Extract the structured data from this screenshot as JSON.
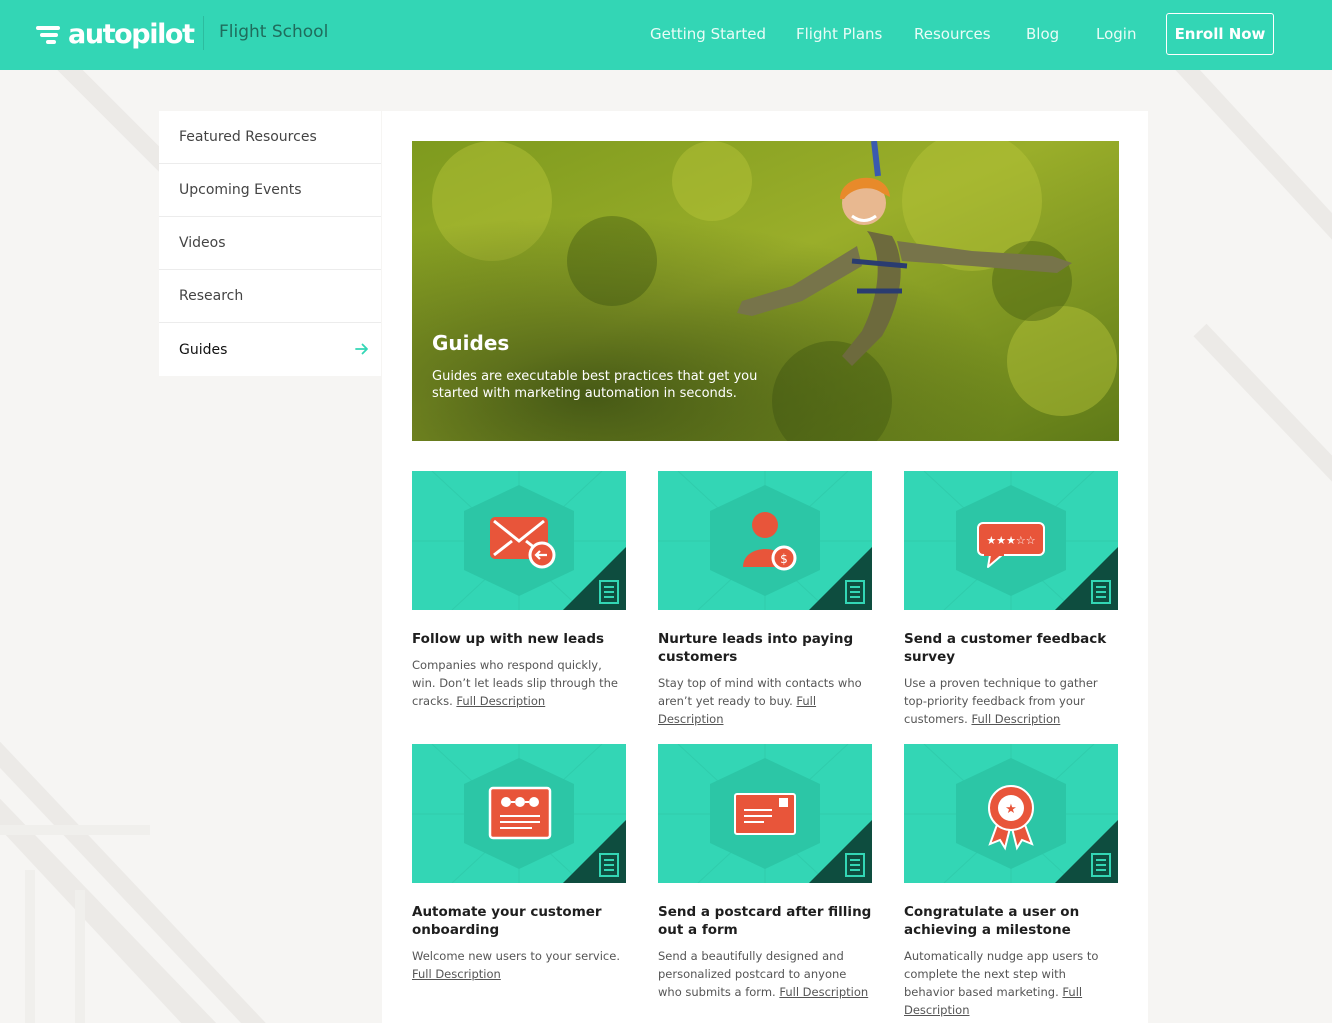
{
  "header": {
    "logo_text": "autopilot",
    "product_name": "Flight School",
    "nav": [
      "Getting Started",
      "Flight Plans",
      "Resources",
      "Blog",
      "Login"
    ],
    "cta": "Enroll Now"
  },
  "sidebar": {
    "items": [
      {
        "label": "Featured Resources"
      },
      {
        "label": "Upcoming Events"
      },
      {
        "label": "Videos"
      },
      {
        "label": "Research"
      },
      {
        "label": "Guides",
        "active": true
      }
    ]
  },
  "hero": {
    "title": "Guides",
    "description": "Guides are executable best practices that get you started with marketing automation in seconds."
  },
  "cards": [
    {
      "title": "Follow up with new leads",
      "description": "Companies who respond quickly, win. Don’t let leads slip through the cracks.",
      "link": "Full Description",
      "icon": "envelope-reply-icon"
    },
    {
      "title": "Nurture leads into paying customers",
      "description": "Stay top of mind with contacts who aren’t yet ready to buy.",
      "link": "Full Description",
      "icon": "user-dollar-icon"
    },
    {
      "title": "Send a customer feedback survey",
      "description": "Use a proven technique to gather top-priority feedback from your customers.",
      "link": "Full Description",
      "icon": "rating-bubble-icon"
    },
    {
      "title": "Automate your customer onboarding",
      "description": "Welcome new users to your service.",
      "link": "Full Description",
      "icon": "onboarding-steps-icon"
    },
    {
      "title": "Send a postcard after filling out a form",
      "description": "Send a beautifully designed and personalized postcard to anyone who submits a form.",
      "link": "Full Description",
      "icon": "postcard-icon"
    },
    {
      "title": "Congratulate a user on achieving a milestone",
      "description": "Automatically nudge app users to complete the next step with behavior based marketing.",
      "link": "Full Description",
      "icon": "award-ribbon-icon"
    }
  ],
  "colors": {
    "brand": "#33d6b5",
    "icon": "#e8553a",
    "thumb_corner": "#0e4d3f"
  }
}
